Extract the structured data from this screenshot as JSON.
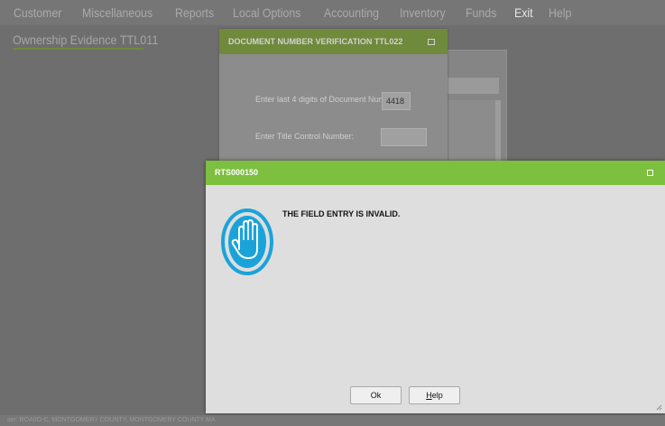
{
  "menu": {
    "items": [
      "Customer",
      "Miscellaneous",
      "Reports",
      "Local Options",
      "Accounting",
      "Inventory",
      "Funds",
      "Exit",
      "Help"
    ]
  },
  "page": {
    "title": "Ownership Evidence TTL011"
  },
  "status_bar": {
    "text": "ser: ROAIIO-C, MONTGOMERY COUNTY, MONTGOMERY COUNTY MA"
  },
  "doc_dialog": {
    "title": "DOCUMENT NUMBER VERIFICATION TTL022",
    "doc_number_label": "Enter last 4 digits of Document Number:",
    "doc_number_value": "4418",
    "tcn_label": "Enter Title Control Number:",
    "tcn_value": ""
  },
  "error_dialog": {
    "title": "RTS000150",
    "message": "THE FIELD ENTRY IS INVALID.",
    "icon": "stop-hand-icon",
    "ok_label": "Ok",
    "help_label_rest": "elp",
    "help_label_mnemonic": "H"
  },
  "colors": {
    "accent_green": "#7dbf3f",
    "dim_green": "#6f8a3b",
    "icon_blue": "#1aa3d9"
  }
}
